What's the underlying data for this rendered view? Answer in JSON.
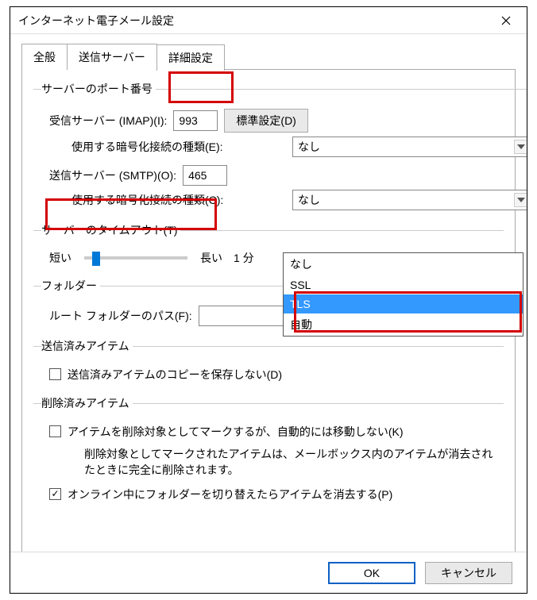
{
  "window": {
    "title": "インターネット電子メール設定"
  },
  "tabs": {
    "general": "全般",
    "outgoing_server": "送信サーバー",
    "advanced": "詳細設定"
  },
  "groups": {
    "ports": "サーバーのポート番号",
    "timeout": "サーバーのタイムアウト(T)",
    "folder": "フォルダー",
    "sent": "送信済みアイテム",
    "deleted": "削除済みアイテム"
  },
  "ports": {
    "imap_label": "受信サーバー (IMAP)(I):",
    "imap_value": "993",
    "default_btn": "標準設定(D)",
    "imap_enc_label": "使用する暗号化接続の種類(E):",
    "imap_enc_value": "なし",
    "smtp_label": "送信サーバー (SMTP)(O):",
    "smtp_value": "465",
    "smtp_enc_label": "使用する暗号化接続の種類(C):",
    "smtp_enc_value": "なし"
  },
  "timeout": {
    "short_label": "短い",
    "long_label": "長い",
    "value_label": "1 分"
  },
  "folder": {
    "root_label": "ルート フォルダーのパス(F):",
    "root_value": ""
  },
  "sent": {
    "no_save_label": "送信済みアイテムのコピーを保存しない(D)",
    "no_save_checked": false
  },
  "deleted": {
    "mark_label": "アイテムを削除対象としてマークするが、自動的には移動しない(K)",
    "mark_checked": false,
    "note": "削除対象としてマークされたアイテムは、メールボックス内のアイテムが消去されたときに完全に削除されます。",
    "purge_label": "オンライン中にフォルダーを切り替えたらアイテムを消去する(P)",
    "purge_checked": true
  },
  "dropdown": {
    "items": [
      "なし",
      "SSL",
      "TLS",
      "自動"
    ],
    "selected": "TLS"
  },
  "buttons": {
    "ok": "OK",
    "cancel": "キャンセル"
  }
}
